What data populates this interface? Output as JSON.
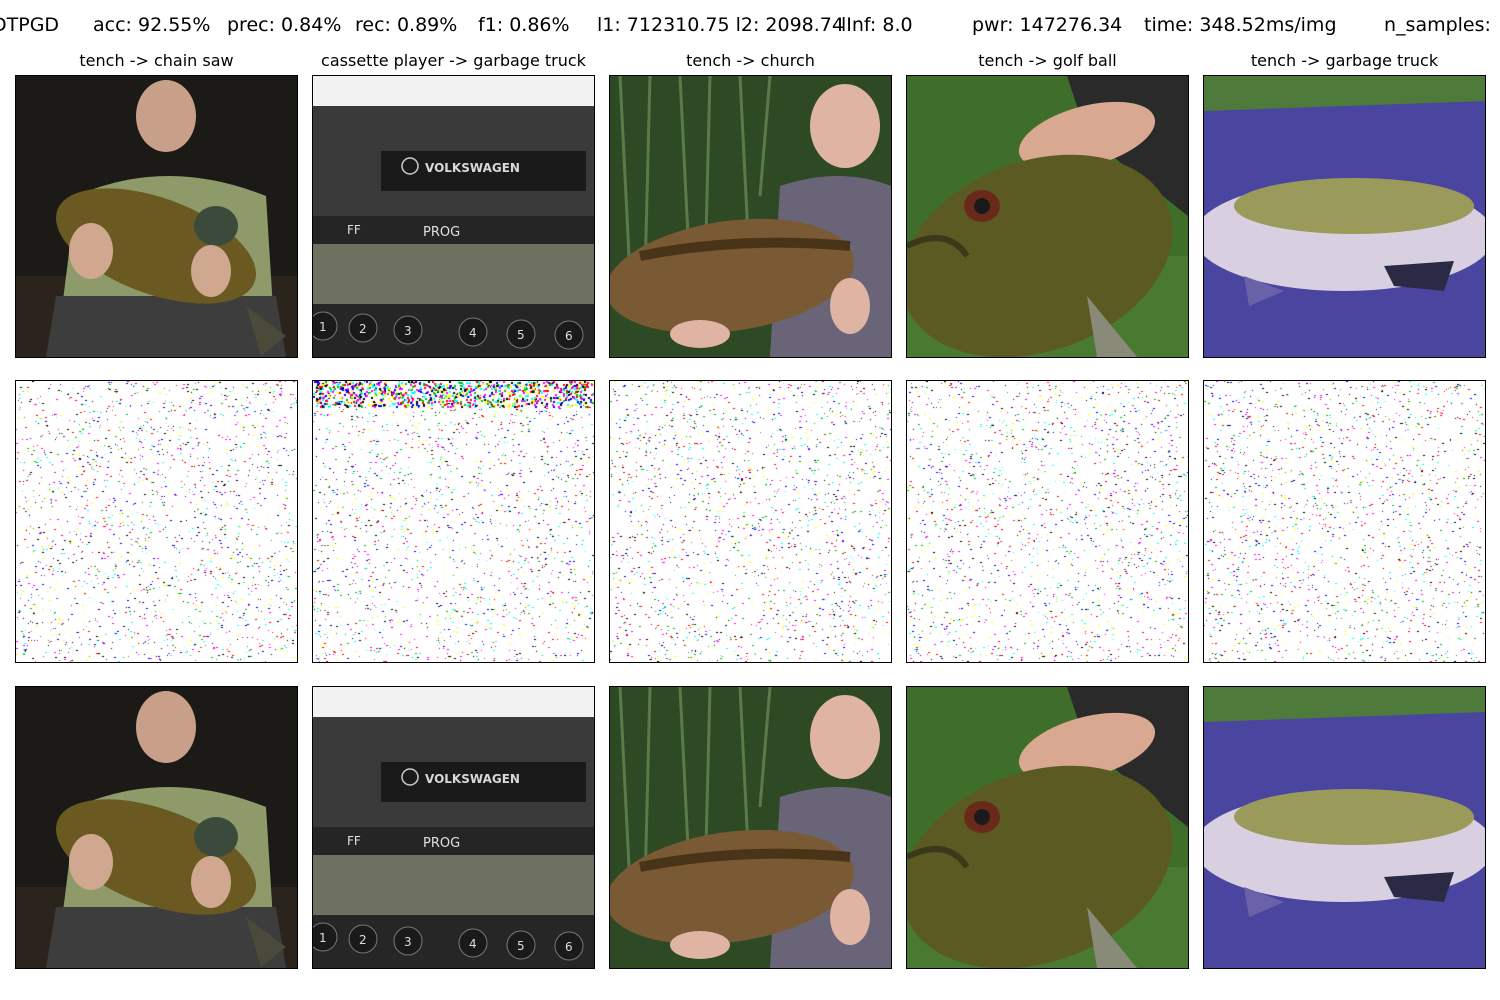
{
  "header": {
    "method": "DTPGD",
    "acc": "acc: 92.55%",
    "prec": "prec: 0.84%",
    "rec": "rec: 0.89%",
    "f1": "f1: 0.86%",
    "l1l2": "l1: 712310.75 l2: 2098.74",
    "linf": "lInf: 8.0",
    "pwr": "pwr: 147276.34",
    "time": "time: 348.52ms/img",
    "n_samples": "n_samples:"
  },
  "columns": [
    {
      "title": "tench -> chain saw",
      "subject": "man-holding-tench-photo",
      "background": "#1c1a16"
    },
    {
      "title": "cassette player -> garbage truck",
      "subject": "car-cassette-radio-photo",
      "background": "#2c2c2c",
      "panel_text": [
        "VOLKSWAGEN",
        "FF",
        "PROG",
        "1",
        "2",
        "3",
        "4",
        "5",
        "6"
      ]
    },
    {
      "title": "tench -> church",
      "subject": "man-holding-carp-photo",
      "background": "#2d4a25"
    },
    {
      "title": "tench -> golf ball",
      "subject": "hand-holding-tench-photo",
      "background": "#3f6e2a"
    },
    {
      "title": "tench -> garbage truck",
      "subject": "tench-on-purple-mat-photo",
      "background": "#3d3a82"
    }
  ],
  "rows": [
    "original-images",
    "perturbations",
    "adversarial-images"
  ],
  "noise_colors": [
    "#ff00ff",
    "#00ffff",
    "#ffff00",
    "#ff0000",
    "#0000ff",
    "#00c000",
    "#000000"
  ]
}
